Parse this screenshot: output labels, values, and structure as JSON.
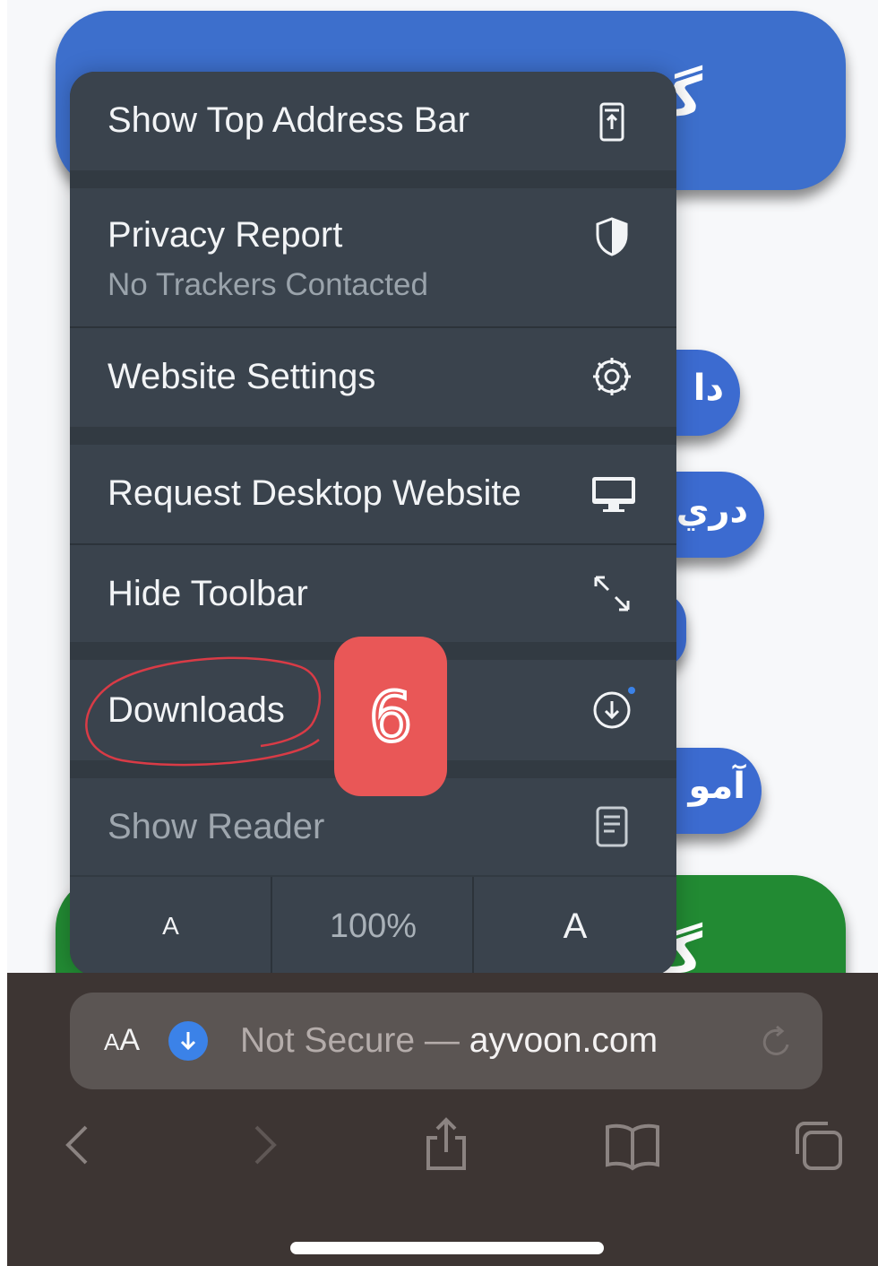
{
  "background_site": {
    "top_button_text": "گ",
    "side_button_1_text": "دا",
    "side_button_2_text": "دري",
    "side_button_4_text": "آمو",
    "bottom_button_text": "گ"
  },
  "menu": {
    "show_top_address_bar": "Show Top Address Bar",
    "privacy_report": "Privacy Report",
    "privacy_report_sub": "No Trackers Contacted",
    "website_settings": "Website Settings",
    "request_desktop_website": "Request Desktop Website",
    "hide_toolbar": "Hide Toolbar",
    "downloads": "Downloads",
    "show_reader": "Show Reader",
    "zoom": {
      "decrease_label": "A",
      "level": "100%",
      "increase_label": "A"
    }
  },
  "annotation": {
    "step_number": "6"
  },
  "address_bar": {
    "aa_small": "A",
    "aa_large": "A",
    "security": "Not Secure —",
    "domain": "ayvoon.com"
  },
  "icons": {
    "address_bar_icon": "phone-address-bar-icon",
    "privacy_icon": "shield-icon",
    "settings_icon": "gear-icon",
    "desktop_icon": "monitor-icon",
    "toolbar_icon": "expand-arrows-icon",
    "downloads_icon": "download-circle-icon",
    "reader_icon": "document-icon",
    "back_icon": "chevron-left-icon",
    "forward_icon": "chevron-right-icon",
    "share_icon": "share-icon",
    "bookmarks_icon": "book-icon",
    "tabs_icon": "tabs-icon",
    "reload_icon": "reload-icon"
  },
  "colors": {
    "menu_background": "#3a434d",
    "badge": "#e95757",
    "download_dot": "#3b82e8",
    "site_blue": "#3d6fcc",
    "site_green": "#228a33"
  }
}
